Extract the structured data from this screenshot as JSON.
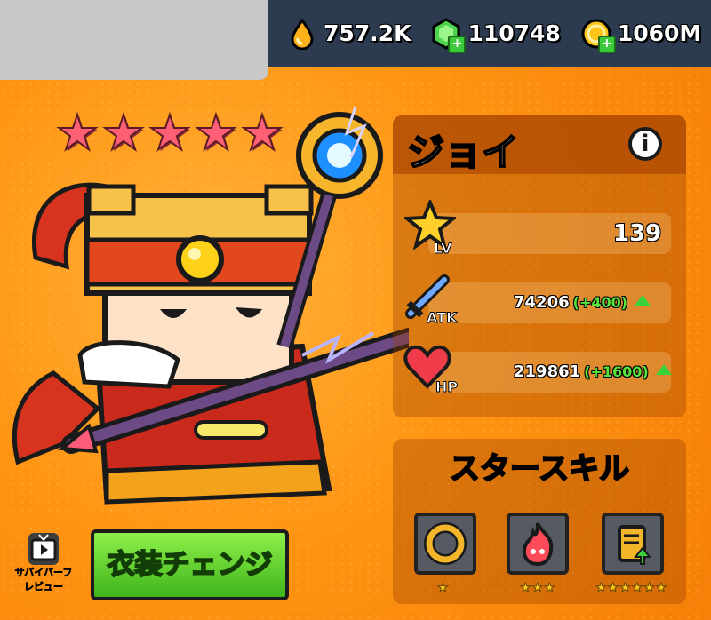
{
  "currencies": [
    {
      "name": "elixir",
      "icon": "droplet-icon",
      "value": "757.2K"
    },
    {
      "name": "gems",
      "icon": "gem-icon",
      "value": "110748"
    },
    {
      "name": "coins",
      "icon": "coin-icon",
      "value": "1060M"
    }
  ],
  "hero": {
    "name": "ジョイ",
    "star_count": 5
  },
  "stats": {
    "lv": {
      "tag": "LV",
      "value": "139"
    },
    "atk": {
      "tag": "ATK",
      "value": "74206",
      "bonus": "(+400)"
    },
    "hp": {
      "tag": "HP",
      "value": "219861",
      "bonus": "(+1600)"
    }
  },
  "star_skills": {
    "title": "スタースキル",
    "skills": [
      {
        "icon": "ring-icon",
        "stars": "★"
      },
      {
        "icon": "flame-icon",
        "stars": "★★★"
      },
      {
        "icon": "scroll-icon",
        "stars": "★★★★★★"
      }
    ]
  },
  "buttons": {
    "costume": "衣装チェンジ",
    "review_line1": "サバイバーフ",
    "review_line2": "レビュー"
  },
  "colors": {
    "top_bar": "#2c3b4f",
    "star_pink": "#ff6075",
    "bonus_green": "#58e23c",
    "button_green": "#5fd12c"
  }
}
